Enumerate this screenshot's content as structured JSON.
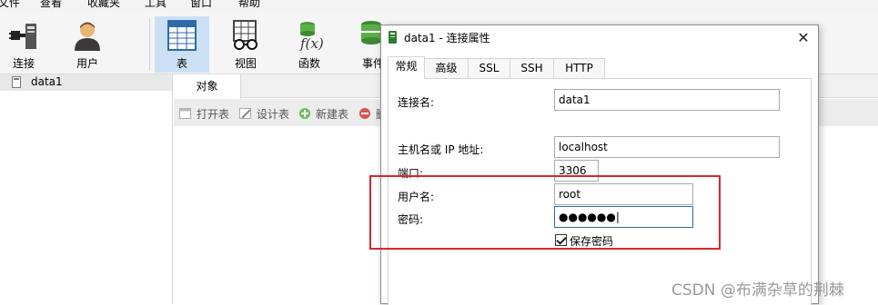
{
  "menu": [
    "文件",
    "查看",
    "收藏夹",
    "工具",
    "窗口",
    "帮助"
  ],
  "toolbar": {
    "buttons": [
      {
        "label": "连接",
        "icon": "connection-plug-icon"
      },
      {
        "label": "用户",
        "icon": "user-icon"
      },
      {
        "label": "表",
        "icon": "table-icon",
        "active": true
      },
      {
        "label": "视图",
        "icon": "view-glasses-icon"
      },
      {
        "label": "函数",
        "icon": "function-fx-icon"
      },
      {
        "label": "事件",
        "icon": "event-icon"
      }
    ]
  },
  "nav": {
    "connection": "data1"
  },
  "main": {
    "objects_tab": "对象",
    "actions": [
      "打开表",
      "设计表",
      "新建表"
    ],
    "partial_action": "删"
  },
  "dialog": {
    "title": "data1 - 连接属性",
    "tabs": [
      "常规",
      "高级",
      "SSL",
      "SSH",
      "HTTP"
    ],
    "fields": {
      "connection_name_label": "连接名:",
      "connection_name_value": "data1",
      "host_label": "主机名或 IP 地址:",
      "host_value": "localhost",
      "port_label": "端口:",
      "port_value": "3306",
      "user_label": "用户名:",
      "user_value": "root",
      "password_label": "密码:",
      "password_value": "●●●●●●|",
      "save_password_label": "保存密码"
    },
    "save_password_checked": true
  },
  "watermark": "CSDN @布满杂草的荆棘",
  "colors": {
    "active_toolbar": "#cce0f5",
    "highlight": "#d9262b",
    "focus_border": "#2b6f8f"
  }
}
